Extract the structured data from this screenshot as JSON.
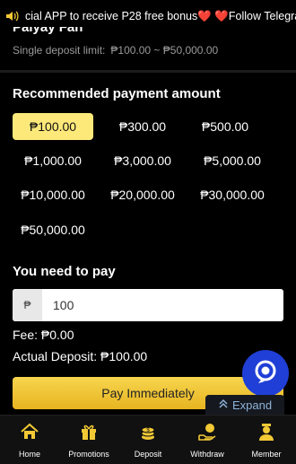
{
  "marquee": {
    "text": "cial APP to receive P28 free bonus",
    "text2": "Follow Telegram: @_",
    "heart": "❤️"
  },
  "deposit": {
    "partial_title": "Paiyay Fan",
    "limit_label": "Single deposit limit:",
    "limit_value": "₱100.00 ~ ₱50,000.00"
  },
  "recommended": {
    "title": "Recommended payment amount",
    "amounts": [
      "₱100.00",
      "₱300.00",
      "₱500.00",
      "₱1,000.00",
      "₱3,000.00",
      "₱5,000.00",
      "₱10,000.00",
      "₱20,000.00",
      "₱30,000.00",
      "₱50,000.00"
    ],
    "selected": "₱100.00"
  },
  "pay": {
    "title": "You need to pay",
    "currency": "₱",
    "value": "100"
  },
  "fee": "Fee: ₱0.00",
  "actual": "Actual Deposit: ₱100.00",
  "button": "Pay Immediately",
  "expand": "Expand",
  "tabs": [
    {
      "label": "Home",
      "icon": "home-icon"
    },
    {
      "label": "Promotions",
      "icon": "gift-icon"
    },
    {
      "label": "Deposit",
      "icon": "coins-icon"
    },
    {
      "label": "Withdraw",
      "icon": "withdraw-icon"
    },
    {
      "label": "Member",
      "icon": "member-icon"
    }
  ],
  "colors": {
    "accent": "#fde97a",
    "button": "#f2c935",
    "chat": "#1f3fd6"
  }
}
